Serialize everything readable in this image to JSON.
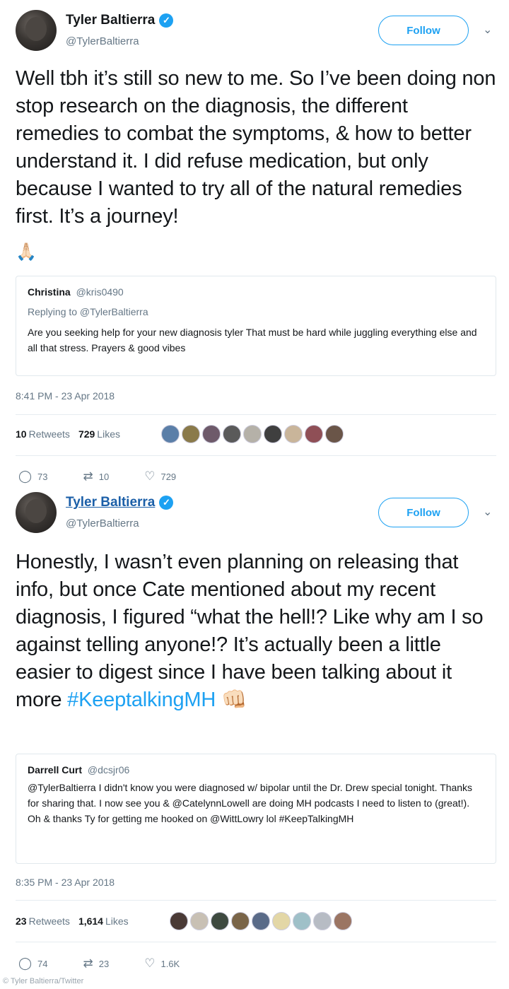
{
  "tweets": [
    {
      "name": "Tyler Baltierra",
      "handle": "@TylerBaltierra",
      "follow_label": "Follow",
      "text": "Well tbh it’s still so new to me. So I’ve been doing non stop research on the diagnosis, the different remedies to combat the symptoms, & how to better understand it. I did refuse medication, but only because I wanted to try all of the natural remedies first. It’s a journey!",
      "emoji": "🙏🏻",
      "quote": {
        "name": "Christina",
        "handle": "@kris0490",
        "reply_to": "Replying to @TylerBaltierra",
        "text": "Are you seeking help for your new diagnosis tyler That must be hard while juggling everything else and all that stress. Prayers & good vibes"
      },
      "timestamp": "8:41 PM - 23 Apr 2018",
      "retweets_count": "10",
      "retweets_label": "Retweets",
      "likes_count": "729",
      "likes_label": "Likes",
      "actions": {
        "replies": "73",
        "retweets": "10",
        "likes": "729"
      }
    },
    {
      "name": "Tyler Baltierra",
      "handle": "@TylerBaltierra",
      "follow_label": "Follow",
      "text": "Honestly, I wasn’t even planning on releasing that info, but once Cate mentioned about my recent diagnosis, I figured “what the hell!? Like why am I so against telling anyone!? It’s actually been a little easier to digest since I have been talking about it more",
      "hashtag": "#KeeptalkingMH",
      "emoji": "👊🏻",
      "quote": {
        "name": "Darrell Curt",
        "handle": "@dcsjr06",
        "text": "@TylerBaltierra I didn't know you were diagnosed w/ bipolar until the Dr. Drew special tonight. Thanks for sharing that. I now see you & @CatelynnLowell are doing MH podcasts I need to listen to (great!). Oh & thanks Ty for getting me hooked on @WittLowry lol #KeepTalkingMH"
      },
      "timestamp": "8:35 PM - 23 Apr 2018",
      "retweets_count": "23",
      "retweets_label": "Retweets",
      "likes_count": "1,614",
      "likes_label": "Likes",
      "actions": {
        "replies": "74",
        "retweets": "23",
        "likes": "1.6K"
      }
    }
  ],
  "icons": {
    "verified": "verified-badge-icon",
    "reply": "reply-icon",
    "retweet": "retweet-icon",
    "like": "heart-icon",
    "chevron": "chevron-down-icon"
  },
  "colors": {
    "accent": "#1da1f2",
    "muted": "#657786"
  },
  "credit": "© Tyler Baltierra/Twitter"
}
